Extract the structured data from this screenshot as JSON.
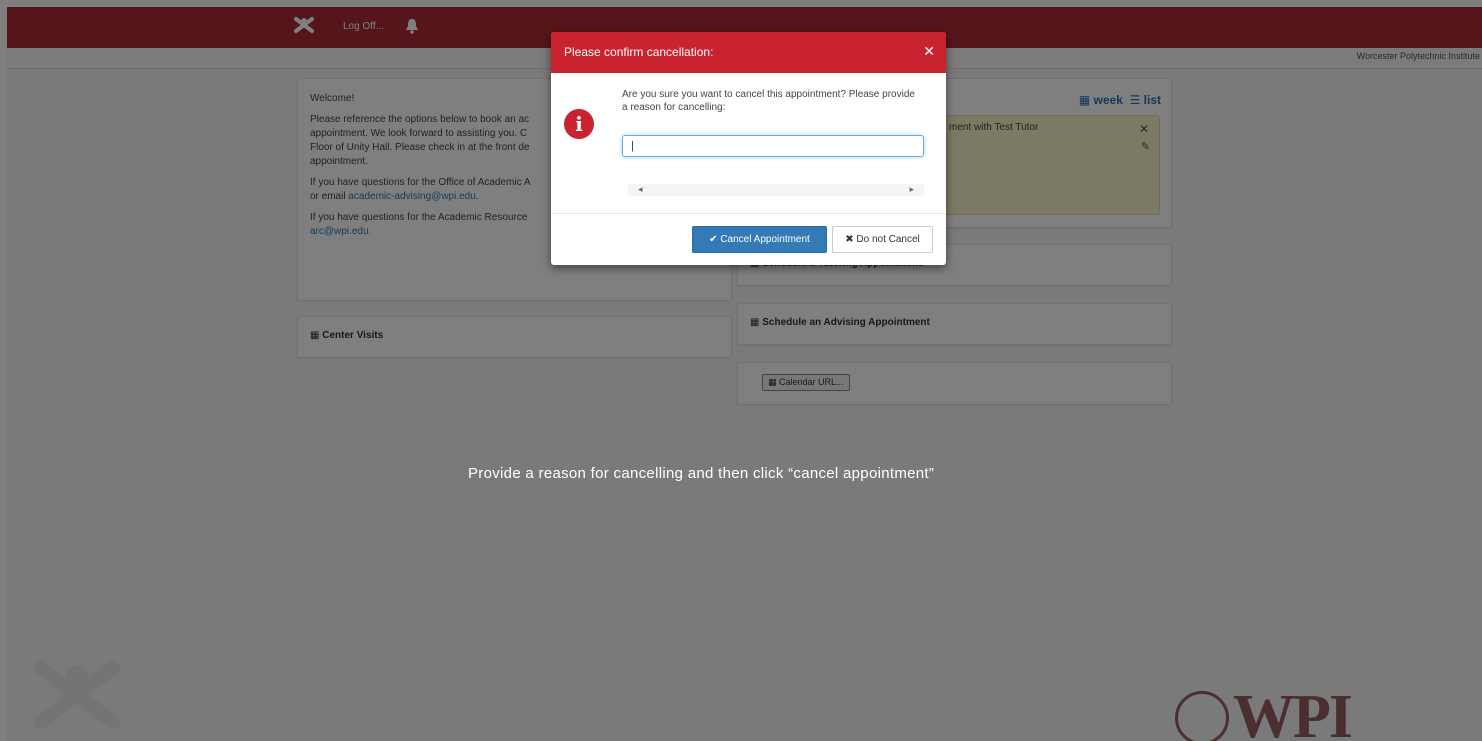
{
  "nav": {
    "logoff_label": "Log Off...",
    "institution": "Worcester Polytechnic Institute"
  },
  "welcome": {
    "title": "Welcome!",
    "line1": "Please reference the options below to book an ac",
    "line2": "appointment.  We look forward to assisting you. C",
    "line3": "Floor of Unity Hall. Please check in at the front de",
    "line4": "appointment.",
    "advising_q": "If you have questions for the Office of Academic A",
    "advising_email_prefix": "or email ",
    "advising_email": "academic-advising@wpi.edu.",
    "arc_q": "If you have questions for the Academic Resource",
    "arc_email": "arc@wpi.edu."
  },
  "calendar": {
    "week_label": "week",
    "list_label": "list",
    "appointment_text": "ment with Test Tutor"
  },
  "panels": {
    "tutoring": "Schedule a Tutoring Appointment",
    "advising": "Schedule an Advising Appointment",
    "center_visits": "Center Visits",
    "calendar_url": "Calendar URL..."
  },
  "modal": {
    "title": "Please confirm cancellation:",
    "message": "Are you sure you want to cancel this appointment? Please provide a reason for cancelling:",
    "reason_value": "|",
    "cancel_button": "Cancel Appointment",
    "keep_button": "Do not Cancel"
  },
  "instruction": "Provide a reason for cancelling and then click “cancel appointment”",
  "branding": {
    "logo_text": "WPI"
  },
  "colors": {
    "brand": "#ac2b37",
    "modal_header": "#c8232e",
    "primary_button": "#337ab7",
    "appointment_bg": "#f8f2c9"
  }
}
